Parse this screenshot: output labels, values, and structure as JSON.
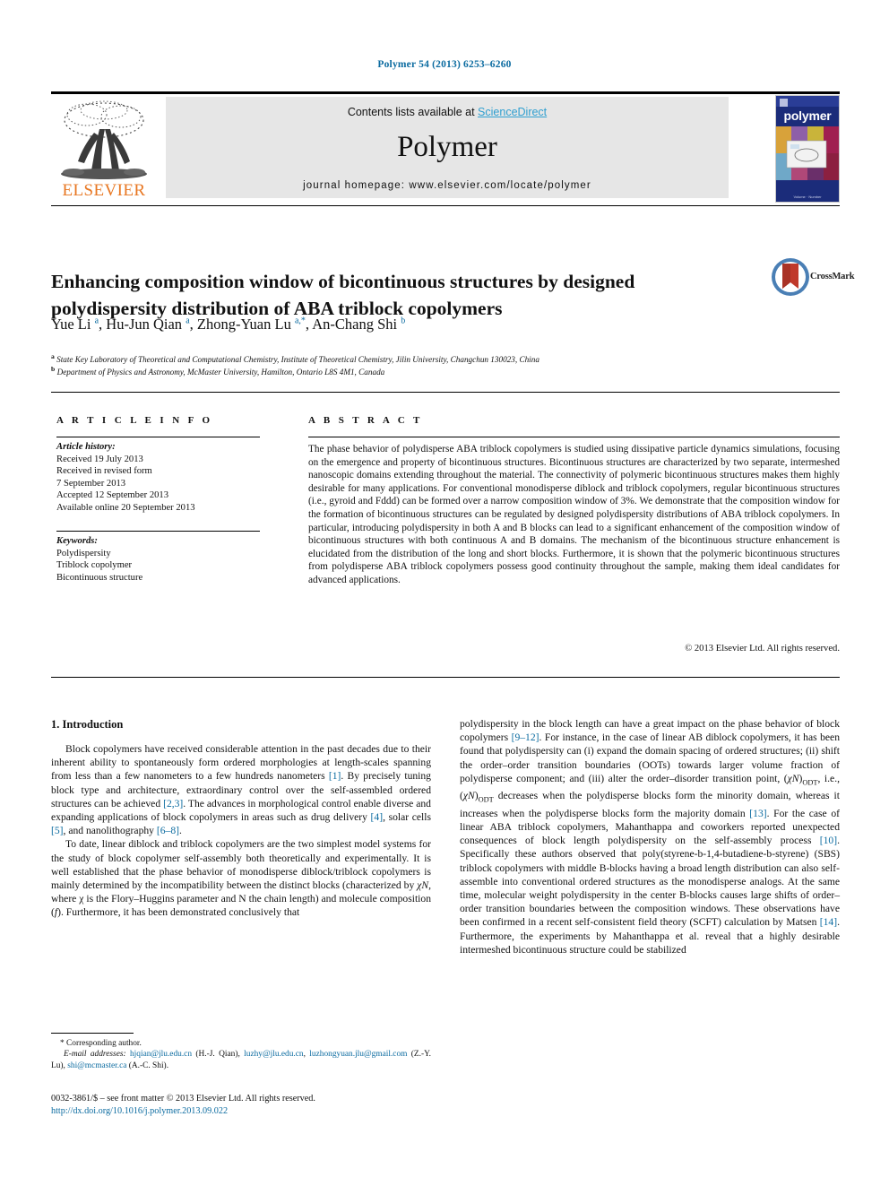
{
  "running_head": "Polymer 54 (2013) 6253–6260",
  "masthead": {
    "publisher": "ELSEVIER",
    "contents_prefix": "Contents lists available at ",
    "contents_link": "ScienceDirect",
    "journal_name": "Polymer",
    "homepage": "journal homepage: www.elsevier.com/locate/polymer",
    "cover_title": "polymer",
    "cover_caption": "Volume · Number"
  },
  "article": {
    "title": "Enhancing composition window of bicontinuous structures by designed polydispersity distribution of ABA triblock copolymers",
    "crossmark_label": "CrossMark",
    "authors_html": "Yue Li <sup>a</sup>, Hu-Jun Qian <sup>a</sup>, Zhong-Yuan Lu <sup>a,</sup><sup>*</sup>, An-Chang Shi <sup>b</sup>",
    "affiliation_a": "State Key Laboratory of Theoretical and Computational Chemistry, Institute of Theoretical Chemistry, Jilin University, Changchun 130023, China",
    "affiliation_b": "Department of Physics and Astronomy, McMaster University, Hamilton, Ontario L8S 4M1, Canada"
  },
  "info": {
    "heading": "A R T I C L E  I N F O",
    "history_label": "Article history:",
    "history": [
      "Received 19 July 2013",
      "Received in revised form",
      "7 September 2013",
      "Accepted 12 September 2013",
      "Available online 20 September 2013"
    ],
    "keywords_label": "Keywords:",
    "keywords": [
      "Polydispersity",
      "Triblock copolymer",
      "Bicontinuous structure"
    ]
  },
  "abstract": {
    "heading": "A B S T R A C T",
    "text": "The phase behavior of polydisperse ABA triblock copolymers is studied using dissipative particle dynamics simulations, focusing on the emergence and property of bicontinuous structures. Bicontinuous structures are characterized by two separate, intermeshed nanoscopic domains extending throughout the material. The connectivity of polymeric bicontinuous structures makes them highly desirable for many applications. For conventional monodisperse diblock and triblock copolymers, regular bicontinuous structures (i.e., gyroid and Fddd) can be formed over a narrow composition window of 3%. We demonstrate that the composition window for the formation of bicontinuous structures can be regulated by designed polydispersity distributions of ABA triblock copolymers. In particular, introducing polydispersity in both A and B blocks can lead to a significant enhancement of the composition window of bicontinuous structures with both continuous A and B domains. The mechanism of the bicontinuous structure enhancement is elucidated from the distribution of the long and short blocks. Furthermore, it is shown that the polymeric bicontinuous structures from polydisperse ABA triblock copolymers possess good continuity throughout the sample, making them ideal candidates for advanced applications.",
    "copyright": "© 2013 Elsevier Ltd. All rights reserved."
  },
  "body": {
    "section_number_title": "1.  Introduction",
    "left_paragraph_1": "Block copolymers have received considerable attention in the past decades due to their inherent ability to spontaneously form ordered morphologies at length-scales spanning from less than a few nanometers to a few hundreds nanometers [1]. By precisely tuning block type and architecture, extraordinary control over the self-assembled ordered structures can be achieved [2,3]. The advances in morphological control enable diverse and expanding applications of block copolymers in areas such as drug delivery [4], solar cells [5], and nanolithography [6–8].",
    "left_paragraph_2": "To date, linear diblock and triblock copolymers are the two simplest model systems for the study of block copolymer self-assembly both theoretically and experimentally. It is well established that the phase behavior of monodisperse diblock/triblock copolymers is mainly determined by the incompatibility between the distinct blocks (characterized by χN, where χ is the Flory–Huggins parameter and N the chain length) and molecule composition (f). Furthermore, it has been demonstrated conclusively that",
    "right_paragraph_1": "polydispersity in the block length can have a great impact on the phase behavior of block copolymers [9–12]. For instance, in the case of linear AB diblock copolymers, it has been found that polydispersity can (i) expand the domain spacing of ordered structures; (ii) shift the order–order transition boundaries (OOTs) towards larger volume fraction of polydisperse component; and (iii) alter the order–disorder transition point, (χN)ODT, i.e., (χN)ODT decreases when the polydisperse blocks form the minority domain, whereas it increases when the polydisperse blocks form the majority domain [13]. For the case of linear ABA triblock copolymers, Mahanthappa and coworkers reported unexpected consequences of block length polydispersity on the self-assembly process [10]. Specifically these authors observed that poly(styrene-b-1,4-butadiene-b-styrene) (SBS) triblock copolymers with middle B-blocks having a broad length distribution can also self-assemble into conventional ordered structures as the monodisperse analogs. At the same time, molecular weight polydispersity in the center B-blocks causes large shifts of order–order transition boundaries between the composition windows. These observations have been confirmed in a recent self-consistent field theory (SCFT) calculation by Matsen [14]. Furthermore, the experiments by Mahanthappa et al. reveal that a highly desirable intermeshed bicontinuous structure could be stabilized"
  },
  "footnotes": {
    "corresponding": "* Corresponding author.",
    "email_label": "E-mail addresses:",
    "emails": [
      {
        "address": "hjqian@jlu.edu.cn",
        "owner": "(H.-J. Qian)"
      },
      {
        "address": "luzhy@jlu.edu.cn",
        "owner": ""
      },
      {
        "address": "luzhongyuan.jlu@gmail.com",
        "owner": "(Z.-Y. Lu)"
      },
      {
        "address": "shi@mcmaster.ca",
        "owner": "(A.-C. Shi)"
      }
    ]
  },
  "imprint": {
    "line": "0032-3861/$ – see front matter © 2013 Elsevier Ltd. All rights reserved.",
    "doi": "http://dx.doi.org/10.1016/j.polymer.2013.09.022"
  },
  "colors": {
    "link": "#0b6ba0",
    "sciencedirect": "#2f9fd0",
    "elsevier_orange": "#E87722",
    "cover_blue": "#1b2c7a"
  }
}
